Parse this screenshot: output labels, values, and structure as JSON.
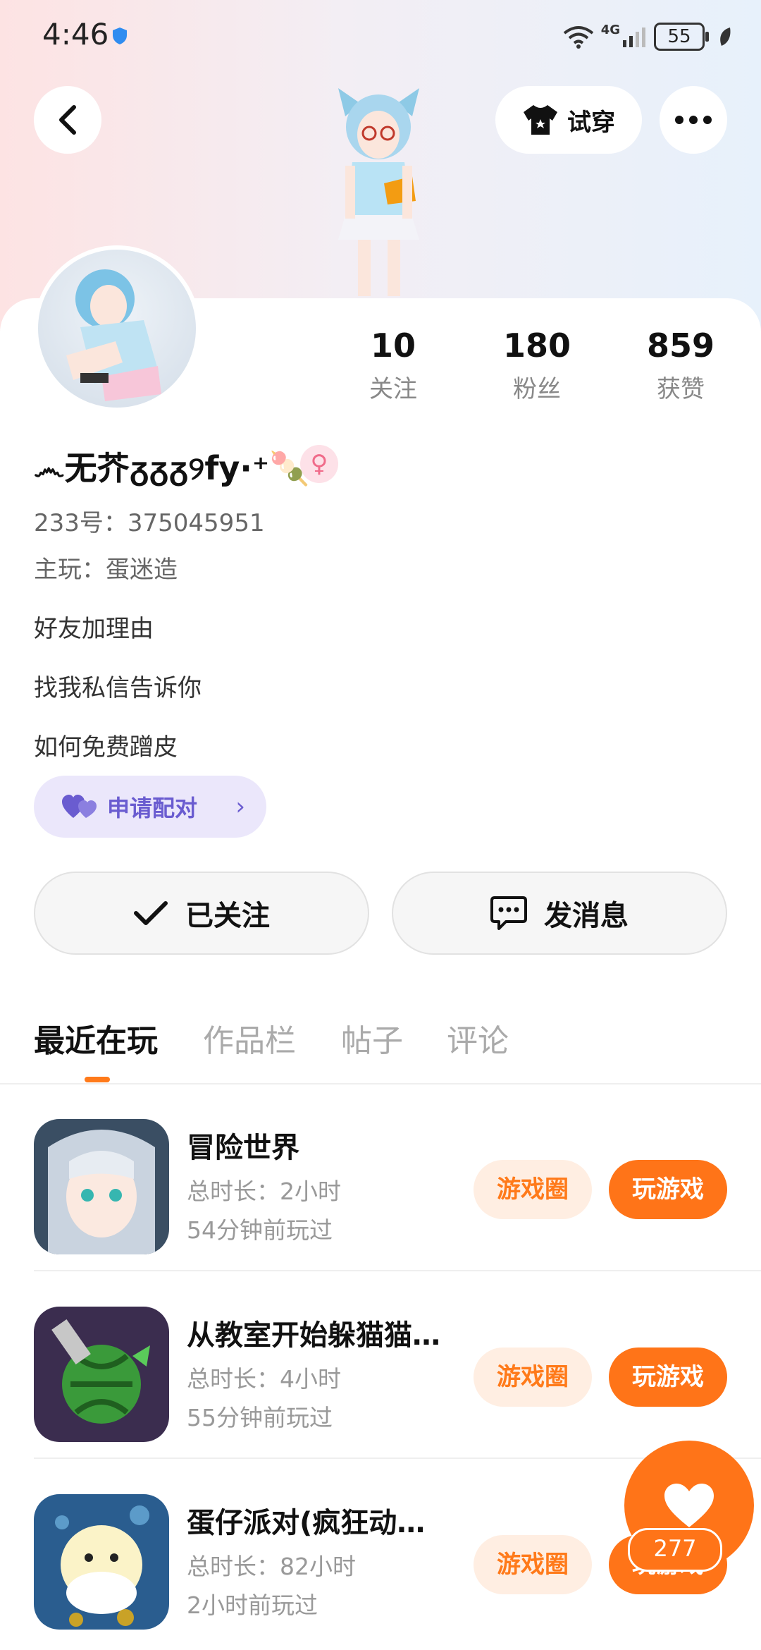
{
  "status_bar": {
    "time": "4:46",
    "network": "4G",
    "battery": "55"
  },
  "header": {
    "try_on_label": "试穿"
  },
  "stats": [
    {
      "value": "10",
      "label": "关注"
    },
    {
      "value": "180",
      "label": "粉丝"
    },
    {
      "value": "859",
      "label": "获赞"
    }
  ],
  "profile": {
    "username": "෴无芥ᵹᵹᵹ୨fy·⁺🍡",
    "gender_symbol": "♀",
    "id_line": "233号：375045951",
    "main_game_line": "主玩：蛋迷造",
    "bio": [
      "好友加理由",
      "找我私信告诉你",
      "如何免费蹭皮"
    ],
    "pair_label": "申请配对"
  },
  "actions": {
    "followed_label": "已关注",
    "message_label": "发消息"
  },
  "tabs": [
    {
      "label": "最近在玩",
      "active": true
    },
    {
      "label": "作品栏",
      "active": false
    },
    {
      "label": "帖子",
      "active": false
    },
    {
      "label": "评论",
      "active": false
    }
  ],
  "games": [
    {
      "name": "冒险世界",
      "duration": "总时长：2小时",
      "last_played": "54分钟前玩过",
      "circle_label": "游戏圈",
      "play_label": "玩游戏"
    },
    {
      "name": "从教室开始躲猫猫…",
      "duration": "总时长：4小时",
      "last_played": "55分钟前玩过",
      "circle_label": "游戏圈",
      "play_label": "玩游戏"
    },
    {
      "name": "蛋仔派对(疯狂动…",
      "duration": "总时长：82小时",
      "last_played": "2小时前玩过",
      "circle_label": "游戏圈",
      "play_label": "玩游戏"
    }
  ],
  "likes_fab": {
    "count": "277"
  },
  "colors": {
    "accent": "#ff7418",
    "accent_soft": "#ffeee2",
    "pair_bg": "#ebe7fb",
    "pair_text": "#6a5cd0"
  }
}
